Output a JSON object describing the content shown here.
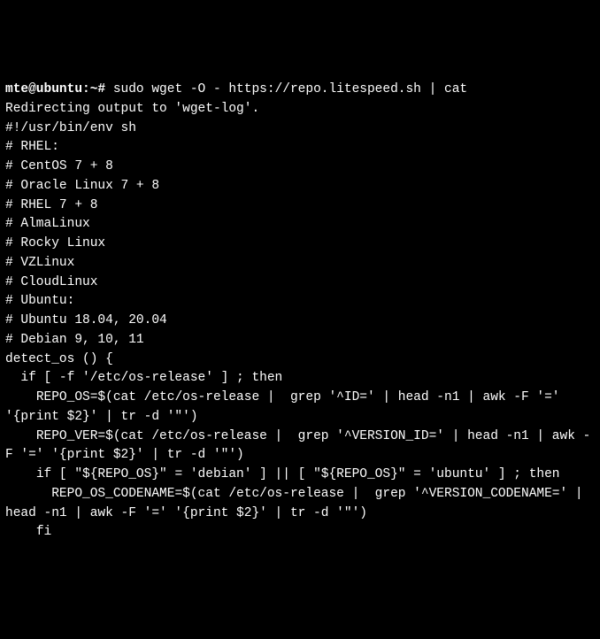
{
  "terminal": {
    "prompt": "mte@ubuntu:~# ",
    "command": "sudo wget -O - https://repo.litespeed.sh | cat",
    "lines": [
      "",
      "Redirecting output to 'wget-log'.",
      "#!/usr/bin/env sh",
      "",
      "# RHEL:",
      "# CentOS 7 + 8",
      "# Oracle Linux 7 + 8",
      "# RHEL 7 + 8",
      "# AlmaLinux",
      "# Rocky Linux",
      "# VZLinux",
      "# CloudLinux",
      "",
      "# Ubuntu:",
      "# Ubuntu 18.04, 20.04",
      "# Debian 9, 10, 11",
      "",
      "detect_os () {",
      "  if [ -f '/etc/os-release' ] ; then",
      "    REPO_OS=$(cat /etc/os-release |  grep '^ID=' | head -n1 | awk -F '=' '{print $2}' | tr -d '\"')",
      "    REPO_VER=$(cat /etc/os-release |  grep '^VERSION_ID=' | head -n1 | awk -F '=' '{print $2}' | tr -d '\"')",
      "    if [ \"${REPO_OS}\" = 'debian' ] || [ \"${REPO_OS}\" = 'ubuntu' ] ; then",
      "      REPO_OS_CODENAME=$(cat /etc/os-release |  grep '^VERSION_CODENAME=' | head -n1 | awk -F '=' '{print $2}' | tr -d '\"')",
      "    fi"
    ]
  }
}
